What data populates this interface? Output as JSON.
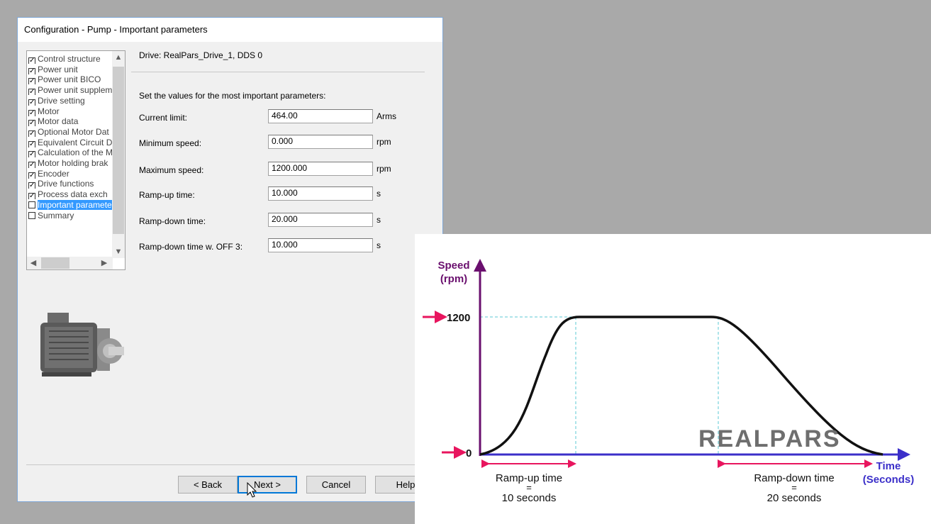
{
  "window": {
    "title": "Configuration - Pump - Important parameters"
  },
  "tree": {
    "items": [
      {
        "label": "Control structure",
        "checked": true
      },
      {
        "label": "Power unit",
        "checked": true
      },
      {
        "label": "Power unit BICO",
        "checked": true
      },
      {
        "label": "Power unit supplem",
        "checked": true
      },
      {
        "label": "Drive setting",
        "checked": true
      },
      {
        "label": "Motor",
        "checked": true
      },
      {
        "label": "Motor data",
        "checked": true
      },
      {
        "label": "Optional Motor Dat",
        "checked": true
      },
      {
        "label": "Equivalent Circuit D",
        "checked": true
      },
      {
        "label": "Calculation of the M",
        "checked": true
      },
      {
        "label": "Motor holding brak",
        "checked": true
      },
      {
        "label": "Encoder",
        "checked": true
      },
      {
        "label": "Drive functions",
        "checked": true
      },
      {
        "label": "Process data exch",
        "checked": true
      },
      {
        "label": "Important paramete",
        "checked": false,
        "selected": true
      },
      {
        "label": "Summary",
        "checked": false
      }
    ],
    "scroll_up": "⌃",
    "scroll_down": "⌄",
    "scroll_left": "<",
    "scroll_right": ">"
  },
  "main": {
    "drive_label": "Drive: RealPars_Drive_1, DDS 0",
    "intro": "Set the values for the most important parameters:",
    "params": [
      {
        "label": "Current limit:",
        "value": "464.00",
        "unit": "Arms"
      },
      {
        "label": "Minimum speed:",
        "value": "0.000",
        "unit": "rpm"
      },
      {
        "label": "Maximum speed:",
        "value": "1200.000",
        "unit": "rpm"
      },
      {
        "label": "Ramp-up time:",
        "value": "10.000",
        "unit": "s"
      },
      {
        "label": "Ramp-down time:",
        "value": "20.000",
        "unit": "s"
      },
      {
        "label": "Ramp-down time w. OFF 3:",
        "value": "10.000",
        "unit": "s"
      }
    ]
  },
  "buttons": {
    "back": "< Back",
    "next": "Next >",
    "cancel": "Cancel",
    "help": "Help"
  },
  "chart_data": {
    "type": "line",
    "ylabel_line1": "Speed",
    "ylabel_line2": "(rpm)",
    "xlabel_line1": "Time",
    "xlabel_line2": "(Seconds)",
    "y_ticks": [
      {
        "value": 0,
        "label": "0"
      },
      {
        "value": 1200,
        "label": "1200"
      }
    ],
    "ramp_up_label": "Ramp-up time",
    "ramp_up_eq": "=",
    "ramp_up_value": "10 seconds",
    "ramp_down_label": "Ramp-down time",
    "ramp_down_eq": "=",
    "ramp_down_value": "20 seconds",
    "logo": "REALPARS",
    "colors": {
      "yaxis": "#6a0f6e",
      "xaxis": "#3b2fc9",
      "arrow": "#e8155e",
      "curve": "#111111",
      "guide": "#5bc8d6"
    }
  }
}
